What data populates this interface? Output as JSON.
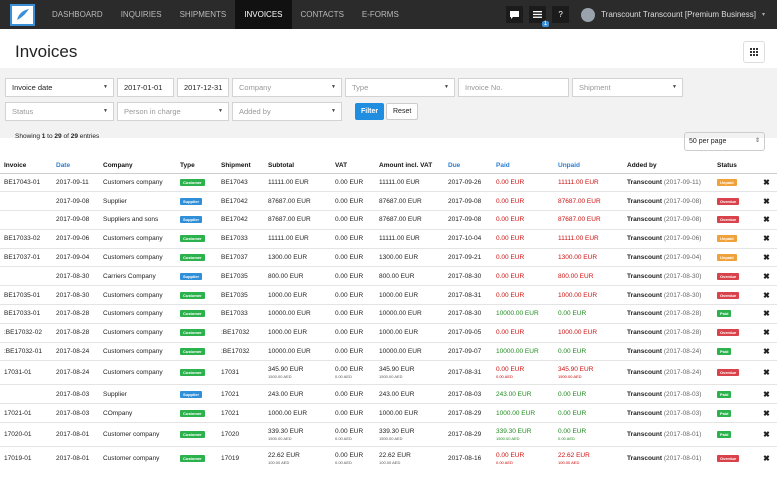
{
  "nav": {
    "items": [
      "DASHBOARD",
      "INQUIRIES",
      "SHIPMENTS",
      "INVOICES",
      "CONTACTS",
      "E-FORMS"
    ],
    "active": "INVOICES",
    "notifications_badge": "1",
    "help_label": "?",
    "user_name": "Transcount Transcount [Premium Business]"
  },
  "page": {
    "title": "Invoices"
  },
  "filters": {
    "invoice_date": "Invoice date",
    "date_from": "2017-01-01",
    "date_to": "2017-12-31",
    "company_ph": "Company",
    "type_ph": "Type",
    "invoice_no_ph": "Invoice No.",
    "shipment_ph": "Shipment",
    "status_ph": "Status",
    "person_ph": "Person in charge",
    "added_by_ph": "Added by",
    "filter_label": "Filter",
    "reset_label": "Reset"
  },
  "info": {
    "prefix": "Showing ",
    "from": "1",
    "mid1": " to ",
    "to": "29",
    "mid2": " of ",
    "total": "29",
    "suffix": " entries"
  },
  "per_page": "50 per page",
  "table": {
    "headers": [
      "Invoice",
      "Date",
      "Company",
      "Type",
      "Shipment",
      "Subtotal",
      "VAT",
      "Amount incl. VAT",
      "Due",
      "Paid",
      "Unpaid",
      "Added by",
      "Status"
    ],
    "rows": [
      {
        "invoice": "BE17043-01",
        "date": "2017-09-11",
        "company": "Customers company",
        "type": "Customer",
        "shipment": "BE17043",
        "subtotal": "11111.00 EUR",
        "vat": "0.00 EUR",
        "amount": "11111.00 EUR",
        "due": "2017-09-26",
        "paid": "0.00 EUR",
        "unpaid": "11111.00 EUR",
        "added_by": "Transcount",
        "added_date": "(2017-09-11)",
        "status": "Unpaid"
      },
      {
        "invoice": "",
        "date": "2017-09-08",
        "company": "Supplier",
        "type": "Supplier",
        "shipment": "BE17042",
        "subtotal": "87687.00 EUR",
        "vat": "0.00 EUR",
        "amount": "87687.00 EUR",
        "due": "2017-09-08",
        "paid": "0.00 EUR",
        "unpaid": "87687.00 EUR",
        "added_by": "Transcount",
        "added_date": "(2017-09-08)",
        "status": "Overdue"
      },
      {
        "invoice": "",
        "date": "2017-09-08",
        "company": "Suppliers and sons",
        "type": "Supplier",
        "shipment": "BE17042",
        "subtotal": "87687.00 EUR",
        "vat": "0.00 EUR",
        "amount": "87687.00 EUR",
        "due": "2017-09-08",
        "paid": "0.00 EUR",
        "unpaid": "87687.00 EUR",
        "added_by": "Transcount",
        "added_date": "(2017-09-08)",
        "status": "Overdue"
      },
      {
        "invoice": "BE17033-02",
        "date": "2017-09-06",
        "company": "Customers company",
        "type": "Customer",
        "shipment": "BE17033",
        "subtotal": "11111.00 EUR",
        "vat": "0.00 EUR",
        "amount": "11111.00 EUR",
        "due": "2017-10-04",
        "paid": "0.00 EUR",
        "unpaid": "11111.00 EUR",
        "added_by": "Transcount",
        "added_date": "(2017-09-06)",
        "status": "Unpaid"
      },
      {
        "invoice": "BE17037-01",
        "date": "2017-09-04",
        "company": "Customers company",
        "type": "Customer",
        "shipment": "BE17037",
        "subtotal": "1300.00 EUR",
        "vat": "0.00 EUR",
        "amount": "1300.00 EUR",
        "due": "2017-09-21",
        "paid": "0.00 EUR",
        "unpaid": "1300.00 EUR",
        "added_by": "Transcount",
        "added_date": "(2017-09-04)",
        "status": "Unpaid"
      },
      {
        "invoice": "",
        "date": "2017-08-30",
        "company": "Carriers Company",
        "type": "Supplier",
        "shipment": "BE17035",
        "subtotal": "800.00 EUR",
        "vat": "0.00 EUR",
        "amount": "800.00 EUR",
        "due": "2017-08-30",
        "paid": "0.00 EUR",
        "unpaid": "800.00 EUR",
        "added_by": "Transcount",
        "added_date": "(2017-08-30)",
        "status": "Overdue"
      },
      {
        "invoice": "BE17035-01",
        "date": "2017-08-30",
        "company": "Customers company",
        "type": "Customer",
        "shipment": "BE17035",
        "subtotal": "1000.00 EUR",
        "vat": "0.00 EUR",
        "amount": "1000.00 EUR",
        "due": "2017-08-31",
        "paid": "0.00 EUR",
        "unpaid": "1000.00 EUR",
        "added_by": "Transcount",
        "added_date": "(2017-08-30)",
        "status": "Overdue"
      },
      {
        "invoice": "BE17033-01",
        "date": "2017-08-28",
        "company": "Customers company",
        "type": "Customer",
        "shipment": "BE17033",
        "subtotal": "10000.00 EUR",
        "vat": "0.00 EUR",
        "amount": "10000.00 EUR",
        "due": "2017-08-30",
        "paid": "10000.00 EUR",
        "unpaid": "0.00 EUR",
        "added_by": "Transcount",
        "added_date": "(2017-08-28)",
        "status": "Paid"
      },
      {
        "invoice": ":BE17032-02",
        "date": "2017-08-28",
        "company": "Customers company",
        "type": "Customer",
        "shipment": ":BE17032",
        "subtotal": "1000.00 EUR",
        "vat": "0.00 EUR",
        "amount": "1000.00 EUR",
        "due": "2017-09-05",
        "paid": "0.00 EUR",
        "unpaid": "1000.00 EUR",
        "added_by": "Transcount",
        "added_date": "(2017-08-28)",
        "status": "Overdue"
      },
      {
        "invoice": ":BE17032-01",
        "date": "2017-08-24",
        "company": "Customers company",
        "type": "Customer",
        "shipment": ":BE17032",
        "subtotal": "10000.00 EUR",
        "vat": "0.00 EUR",
        "amount": "10000.00 EUR",
        "due": "2017-09-07",
        "paid": "10000.00 EUR",
        "unpaid": "0.00 EUR",
        "added_by": "Transcount",
        "added_date": "(2017-08-24)",
        "status": "Paid"
      },
      {
        "invoice": "17031-01",
        "date": "2017-08-24",
        "company": "Customers company",
        "type": "Customer",
        "shipment": "17031",
        "subtotal": "345.90 EUR",
        "subtotal_sub": "1500.00 AED",
        "vat": "0.00 EUR",
        "vat_sub": "0.00 AED",
        "amount": "345.90 EUR",
        "amount_sub": "1500.00 AED",
        "due": "2017-08-31",
        "paid": "0.00 EUR",
        "paid_sub": "0.00 AED",
        "unpaid": "345.90 EUR",
        "unpaid_sub": "1500.00 AED",
        "added_by": "Transcount",
        "added_date": "(2017-08-24)",
        "status": "Overdue"
      },
      {
        "invoice": "",
        "date": "2017-08-03",
        "company": "Supplier",
        "type": "Supplier",
        "shipment": "17021",
        "subtotal": "243.00 EUR",
        "vat": "0.00 EUR",
        "amount": "243.00 EUR",
        "due": "2017-08-03",
        "paid": "243.00 EUR",
        "unpaid": "0.00 EUR",
        "added_by": "Transcount",
        "added_date": "(2017-08-03)",
        "status": "Paid"
      },
      {
        "invoice": "17021-01",
        "date": "2017-08-03",
        "company": "COmpany",
        "type": "Customer",
        "shipment": "17021",
        "subtotal": "1000.00 EUR",
        "vat": "0.00 EUR",
        "amount": "1000.00 EUR",
        "due": "2017-08-29",
        "paid": "1000.00 EUR",
        "unpaid": "0.00 EUR",
        "added_by": "Transcount",
        "added_date": "(2017-08-03)",
        "status": "Paid"
      },
      {
        "invoice": "17020-01",
        "date": "2017-08-01",
        "company": "Customer company",
        "type": "Customer",
        "shipment": "17020",
        "subtotal": "339.30 EUR",
        "subtotal_sub": "1500.00 AED",
        "vat": "0.00 EUR",
        "vat_sub": "0.00 AED",
        "amount": "339.30 EUR",
        "amount_sub": "1500.00 AED",
        "due": "2017-08-29",
        "paid": "339.30 EUR",
        "paid_sub": "1500.00 AED",
        "unpaid": "0.00 EUR",
        "unpaid_sub": "0.00 AED",
        "added_by": "Transcount",
        "added_date": "(2017-08-01)",
        "status": "Paid"
      },
      {
        "invoice": "17019-01",
        "date": "2017-08-01",
        "company": "Customer company",
        "type": "Customer",
        "shipment": "17019",
        "subtotal": "22.62 EUR",
        "subtotal_sub": "100.00 AED",
        "vat": "0.00 EUR",
        "vat_sub": "0.00 AED",
        "amount": "22.62 EUR",
        "amount_sub": "100.00 AED",
        "due": "2017-08-16",
        "paid": "0.00 EUR",
        "paid_sub": "0.00 AED",
        "unpaid": "22.62 EUR",
        "unpaid_sub": "100.00 AED",
        "added_by": "Transcount",
        "added_date": "(2017-08-01)",
        "status": "Overdue"
      }
    ]
  },
  "colors": {
    "accent": "#1f8de0",
    "customer": "#2bb24c",
    "supplier": "#2f8fd8",
    "unpaid": "#f0a23a",
    "overdue": "#d9424a",
    "paid": "#2bb24c"
  }
}
